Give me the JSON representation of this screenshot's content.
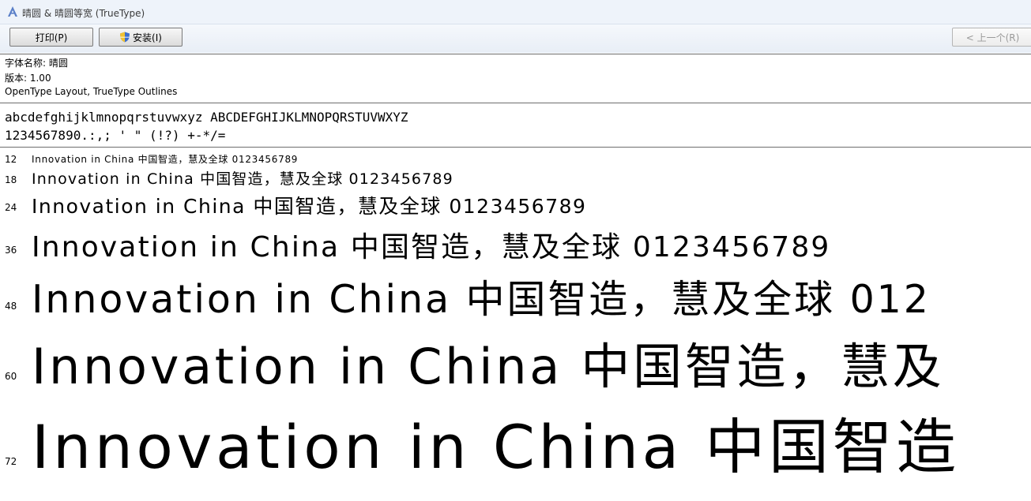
{
  "window": {
    "title": "晴圆 & 晴圆等宽 (TrueType)",
    "app_icon": "font-viewer-icon"
  },
  "toolbar": {
    "print_label": "打印(P)",
    "install_label": "安装(I)",
    "prev_label": "< 上一个(R)"
  },
  "font_info": {
    "name_line": "字体名称: 晴圆",
    "version_line": "版本: 1.00",
    "type_line": "OpenType Layout, TrueType Outlines"
  },
  "character_set": {
    "line1": "abcdefghijklmnopqrstuvwxyz ABCDEFGHIJKLMNOPQRSTUVWXYZ",
    "line2": "1234567890.:,; ' \" (!?) +-*/="
  },
  "samples": [
    {
      "size": "12",
      "text": "Innovation in China 中国智造，慧及全球 0123456789"
    },
    {
      "size": "18",
      "text": "Innovation in China 中国智造，慧及全球 0123456789"
    },
    {
      "size": "24",
      "text": "Innovation in China 中国智造，慧及全球 0123456789"
    },
    {
      "size": "36",
      "text": "Innovation in China 中国智造，慧及全球 0123456789"
    },
    {
      "size": "48",
      "text": "Innovation in China 中国智造，慧及全球 012"
    },
    {
      "size": "60",
      "text": "Innovation in China 中国智造，慧及"
    },
    {
      "size": "72",
      "text": "Innovation in China 中国智造"
    }
  ]
}
